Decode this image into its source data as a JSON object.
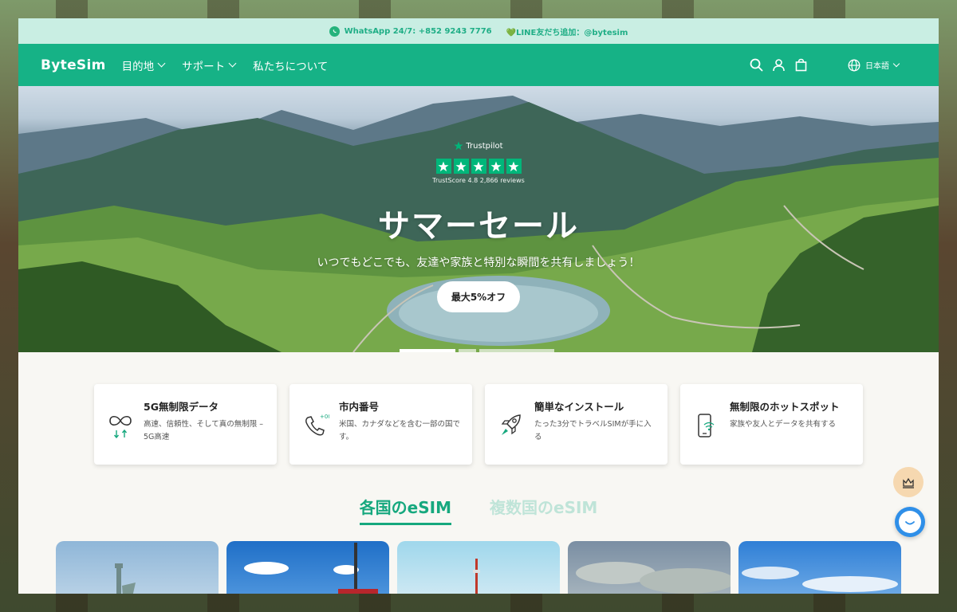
{
  "announcement": {
    "whatsapp": "WhatsApp 24/7: +852 9243 7776",
    "line": "💚LINE友だち追加：@bytesim"
  },
  "nav": {
    "logo": "ByteSim",
    "items": [
      {
        "label": "目的地",
        "has_dropdown": true
      },
      {
        "label": "サポート",
        "has_dropdown": true
      },
      {
        "label": "私たちについて",
        "has_dropdown": false
      }
    ],
    "icons": [
      "search-icon",
      "account-icon",
      "cart-icon"
    ],
    "language": "日本語"
  },
  "hero": {
    "trustpilot_brand": "Trustpilot",
    "trustpilot_stars": 5,
    "trustscore": "TrustScore 4.8 2,866 reviews",
    "title": "サマーセール",
    "subtitle": "いつでもどこでも、友達や家族と特別な瞬間を共有しましょう！",
    "cta": "最大5%オフ"
  },
  "features": [
    {
      "icon": "infinity-icon",
      "title": "5G無制限データ",
      "desc": "高速、信頼性、そして真の無制限 – 5G高速"
    },
    {
      "icon": "phone-plus-icon",
      "title": "市内番号",
      "desc": "米国、カナダなどを含む一部の国です。"
    },
    {
      "icon": "rocket-icon",
      "title": "簡単なインストール",
      "desc": "たった3分でトラベルSIMが手に入る"
    },
    {
      "icon": "hotspot-icon",
      "title": "無制限のホットスポット",
      "desc": "家族や友人とデータを共有する"
    }
  ],
  "tabs": [
    {
      "label": "各国のeSIM",
      "active": true
    },
    {
      "label": "複数国のeSIM",
      "active": false
    }
  ],
  "destination_cards": [
    "statue-of-liberty-image",
    "japan-tower-image",
    "tokyo-skyline-image",
    "cloudy-sky-image",
    "blue-sky-image"
  ],
  "colors": {
    "brand": "#16b286",
    "announce_bg": "#c9eee3",
    "trustpilot": "#00b67a"
  }
}
